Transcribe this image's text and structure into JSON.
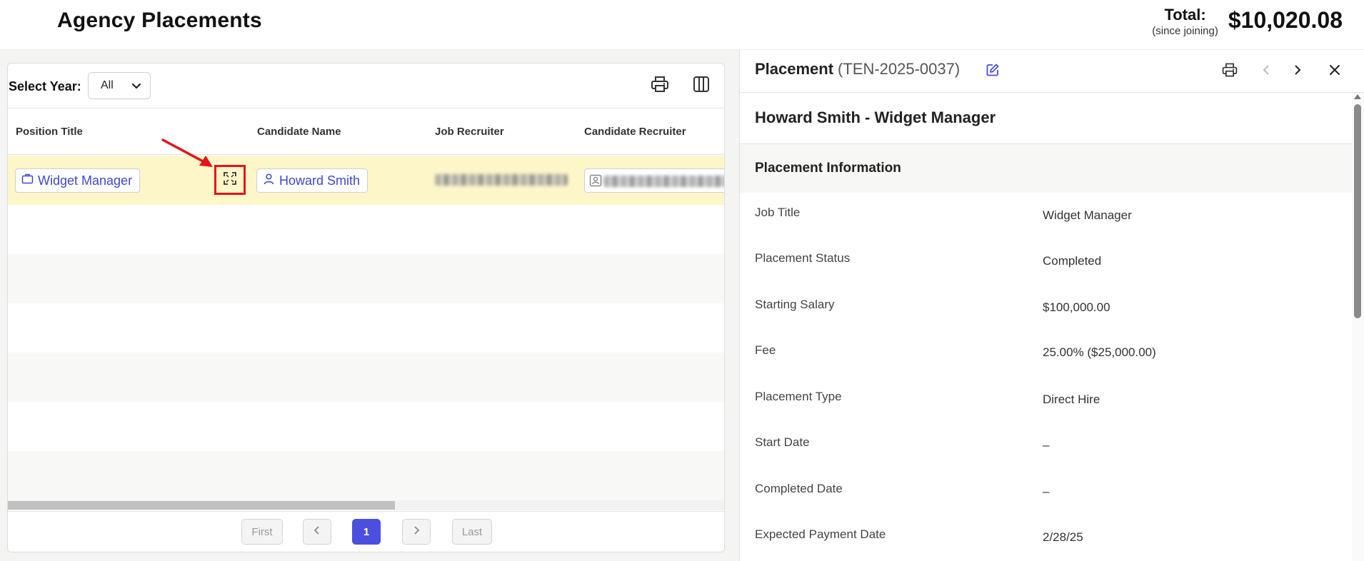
{
  "header": {
    "title": "Agency Placements",
    "total_label": "Total:",
    "total_sub": "(since joining)",
    "total_value": "$10,020.08"
  },
  "toolbar": {
    "year_label": "Select Year:",
    "year_value": "All",
    "icons": [
      "printer-icon",
      "columns-icon"
    ]
  },
  "table": {
    "columns": [
      "Position Title",
      "Candidate Name",
      "Job Recruiter",
      "Candidate Recruiter"
    ],
    "rows": [
      {
        "position": "Widget Manager",
        "candidate": "Howard Smith"
      }
    ]
  },
  "pager": {
    "first": "First",
    "last": "Last",
    "current": "1"
  },
  "panel": {
    "title": "Placement",
    "code": "(TEN-2025-0037)",
    "record_title": "Howard Smith - Widget Manager",
    "section_title": "Placement Information",
    "fields": [
      {
        "label": "Job Title",
        "value": "Widget Manager"
      },
      {
        "label": "Placement Status",
        "value": "Completed"
      },
      {
        "label": "Starting Salary",
        "value": "$100,000.00"
      },
      {
        "label": "Fee",
        "value": "25.00% ($25,000.00)"
      },
      {
        "label": "Placement Type",
        "value": "Direct Hire"
      },
      {
        "label": "Start Date",
        "value": "–"
      },
      {
        "label": "Completed Date",
        "value": "–"
      },
      {
        "label": "Expected Payment Date",
        "value": "2/28/25"
      }
    ]
  },
  "colors": {
    "selected_row": "#fdf6c8",
    "accent": "#4b4fe0",
    "link": "#3f48c8",
    "annotation": "#e3141e"
  }
}
